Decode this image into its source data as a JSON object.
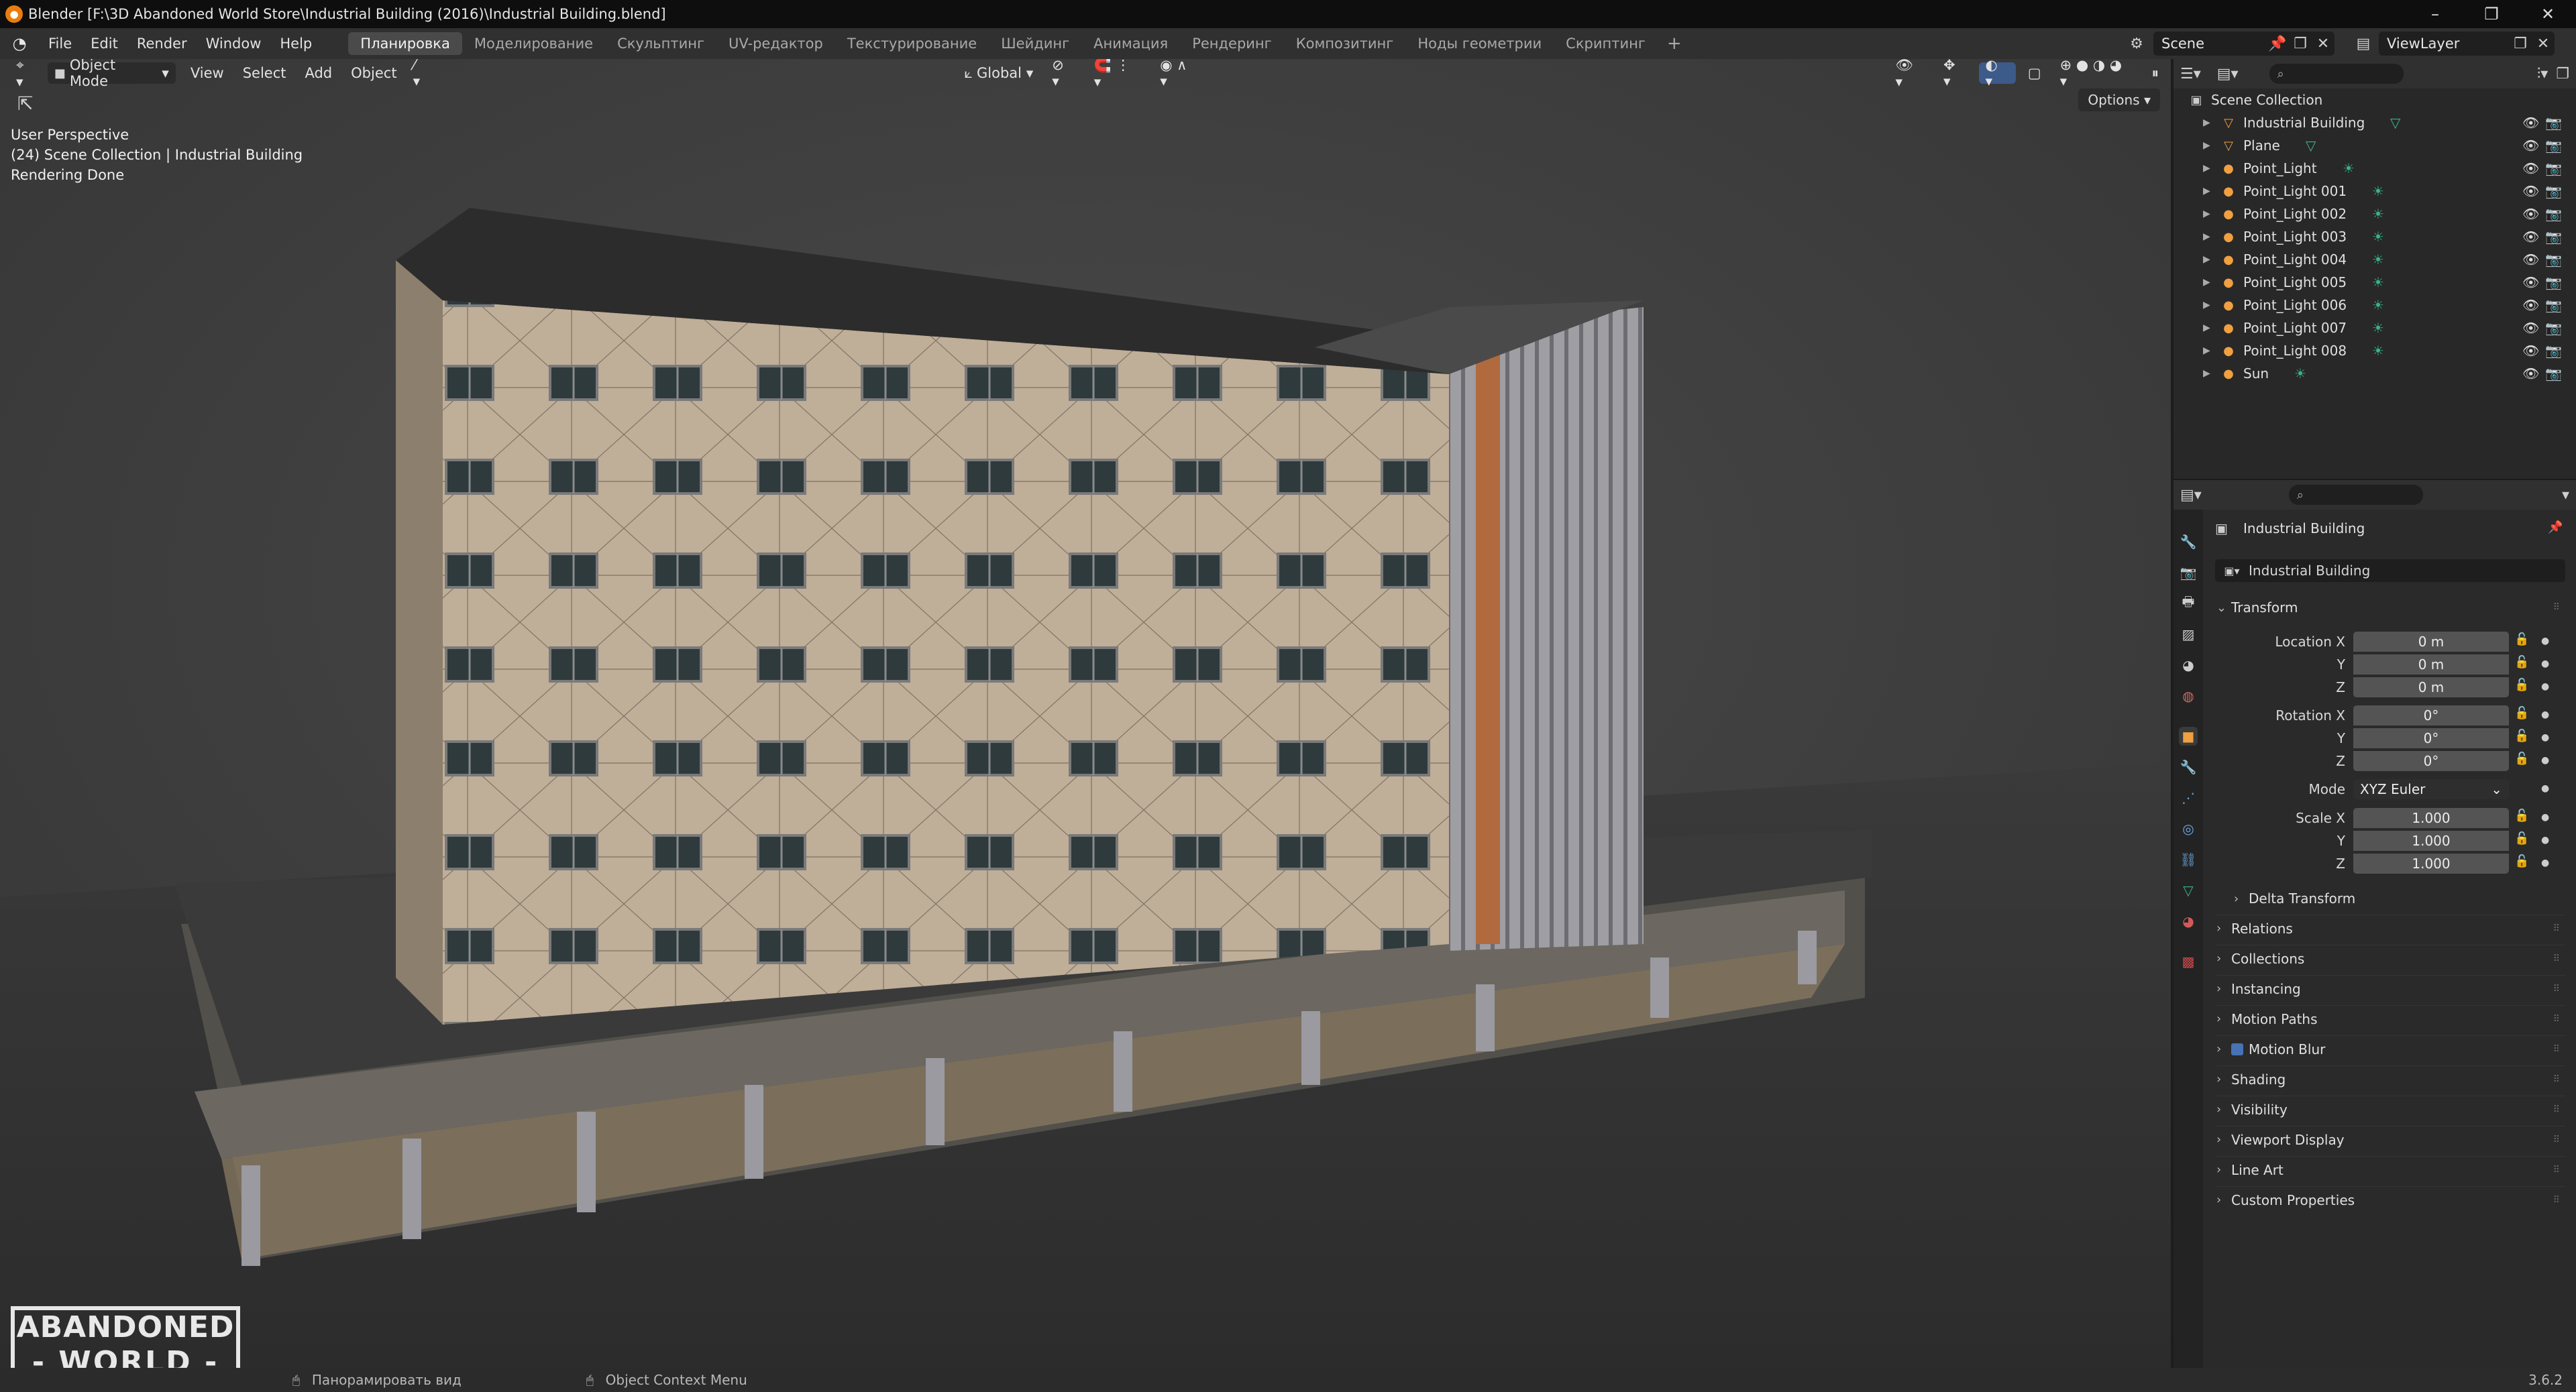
{
  "title_bar": {
    "title": "Blender [F:\\3D Abandoned World Store\\Industrial Building (2016)\\Industrial Building.blend]"
  },
  "menu": {
    "items": [
      "File",
      "Edit",
      "Render",
      "Window",
      "Help"
    ]
  },
  "workspaces": [
    "Планировка",
    "Моделирование",
    "Скульптинг",
    "UV-редактор",
    "Текстурирование",
    "Шейдинг",
    "Анимация",
    "Рендеринг",
    "Композитинг",
    "Ноды геометрии",
    "Скриптинг"
  ],
  "scene": {
    "name": "Scene",
    "view_layer": "ViewLayer"
  },
  "viewport": {
    "mode": "Object Mode",
    "menus": [
      "View",
      "Select",
      "Add",
      "Object"
    ],
    "transform_orientation": "Global",
    "options_label": "Options",
    "overlay_lines": [
      "User Perspective",
      "(24) Scene Collection | Industrial Building",
      "Rendering Done"
    ],
    "logo_lines": [
      "ABANDONED",
      "- WORLD -"
    ]
  },
  "outliner": {
    "root": "Scene Collection",
    "items": [
      {
        "name": "Industrial Building",
        "icon": "mesh-icon"
      },
      {
        "name": "Plane",
        "icon": "mesh-icon"
      },
      {
        "name": "Point_Light",
        "icon": "light-icon"
      },
      {
        "name": "Point_Light 001",
        "icon": "light-icon"
      },
      {
        "name": "Point_Light 002",
        "icon": "light-icon"
      },
      {
        "name": "Point_Light 003",
        "icon": "light-icon"
      },
      {
        "name": "Point_Light 004",
        "icon": "light-icon"
      },
      {
        "name": "Point_Light 005",
        "icon": "light-icon"
      },
      {
        "name": "Point_Light 006",
        "icon": "light-icon"
      },
      {
        "name": "Point_Light 007",
        "icon": "light-icon"
      },
      {
        "name": "Point_Light 008",
        "icon": "light-icon"
      },
      {
        "name": "Sun",
        "icon": "sun-icon"
      }
    ]
  },
  "properties": {
    "object_name": "Industrial Building",
    "object_field": "Industrial Building",
    "transform_label": "Transform",
    "location": {
      "label": "Location X",
      "x": "0 m",
      "y": "0 m",
      "z": "0 m"
    },
    "rotation": {
      "label": "Rotation X",
      "x": "0°",
      "y": "0°",
      "z": "0°"
    },
    "mode_label": "Mode",
    "mode_value": "XYZ Euler",
    "scale": {
      "label": "Scale X",
      "x": "1.000",
      "y": "1.000",
      "z": "1.000"
    },
    "axis_y": "Y",
    "axis_z": "Z",
    "delta_transform": "Delta Transform",
    "sections": [
      "Relations",
      "Collections",
      "Instancing",
      "Motion Paths",
      "Motion Blur",
      "Shading",
      "Visibility",
      "Viewport Display",
      "Line Art",
      "Custom Properties"
    ]
  },
  "status_bar": {
    "pan": "Панорамировать вид",
    "context_menu": "Object Context Menu",
    "version": "3.6.2"
  }
}
